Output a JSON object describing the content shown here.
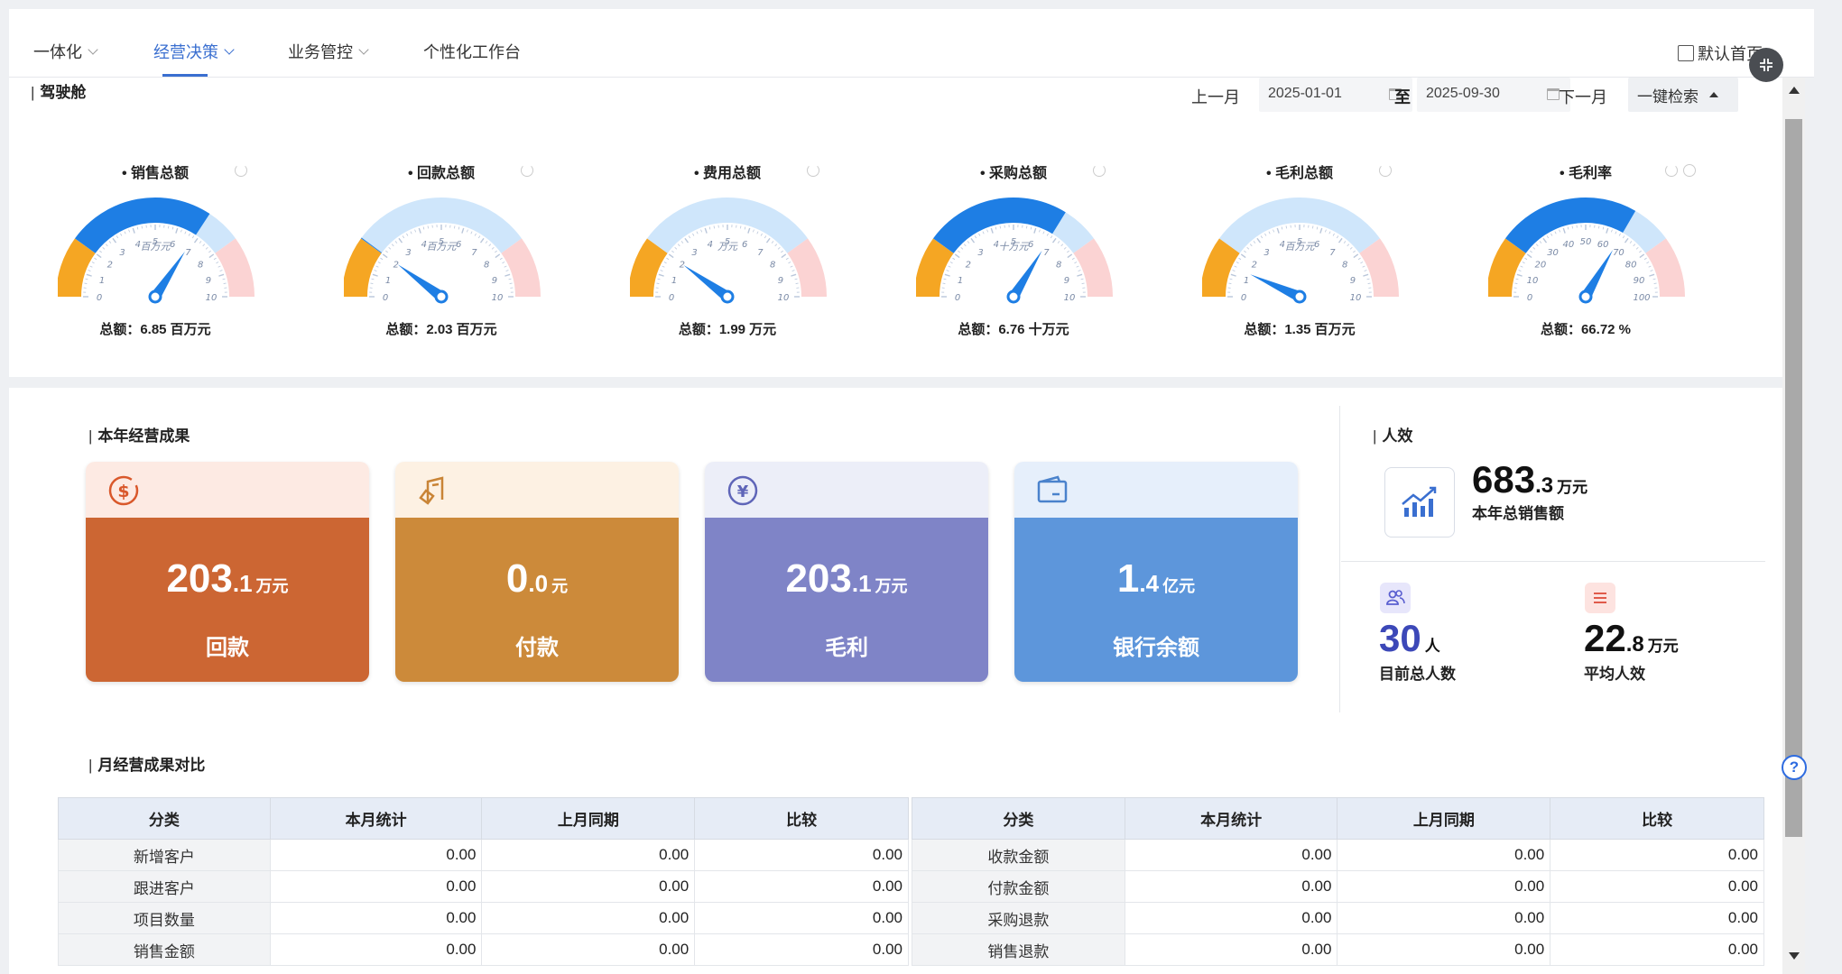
{
  "nav": {
    "tabs": [
      {
        "label": "一体化"
      },
      {
        "label": "经营决策"
      },
      {
        "label": "业务管控"
      },
      {
        "label": "个性化工作台"
      }
    ],
    "default_home": "默认首页"
  },
  "cockpit": {
    "title": "驾驶舱",
    "prev_month": "上一月",
    "next_month": "下一月",
    "start_date": "2025-01-01",
    "end_date": "2025-09-30",
    "to_label": "至",
    "search_label": "一键检索"
  },
  "gauges": [
    {
      "title": "销售总额",
      "unit_label": "百万元",
      "ticks": [
        "0",
        "1",
        "2",
        "3",
        "4",
        "5",
        "6",
        "7",
        "8",
        "9",
        "10"
      ],
      "max": 10,
      "value": 6.85,
      "total_text": "总额：6.85 百万元"
    },
    {
      "title": "回款总额",
      "unit_label": "百万元",
      "ticks": [
        "0",
        "1",
        "2",
        "3",
        "4",
        "5",
        "6",
        "7",
        "8",
        "9",
        "10"
      ],
      "max": 10,
      "value": 2.03,
      "total_text": "总额：2.03 百万元"
    },
    {
      "title": "费用总额",
      "unit_label": "万元",
      "ticks": [
        "0",
        "1",
        "2",
        "3",
        "4",
        "5",
        "6",
        "7",
        "8",
        "9",
        "10"
      ],
      "max": 10,
      "value": 1.99,
      "total_text": "总额：1.99 万元"
    },
    {
      "title": "采购总额",
      "unit_label": "十万元",
      "ticks": [
        "0",
        "1",
        "2",
        "3",
        "4",
        "5",
        "6",
        "7",
        "8",
        "9",
        "10"
      ],
      "max": 10,
      "value": 6.76,
      "total_text": "总额：6.76 十万元"
    },
    {
      "title": "毛利总额",
      "unit_label": "百万元",
      "ticks": [
        "0",
        "1",
        "2",
        "3",
        "4",
        "5",
        "6",
        "7",
        "8",
        "9",
        "10"
      ],
      "max": 10,
      "value": 1.35,
      "total_text": "总额：1.35 百万元"
    },
    {
      "title": "毛利率",
      "unit_label": "",
      "ticks": [
        "0",
        "10",
        "20",
        "30",
        "40",
        "50",
        "60",
        "70",
        "80",
        "90",
        "100"
      ],
      "max": 100,
      "value": 66.72,
      "total_text": "总额：66.72 %"
    }
  ],
  "results": {
    "title": "本年经营成果",
    "cards": [
      {
        "int": "203",
        "dec": ".1",
        "unit": "万元",
        "label": "回款",
        "icon": "dollar-icon",
        "head_color": "#fdeae3",
        "body_color": "#cc6633",
        "icon_color": "#d9582b"
      },
      {
        "int": "0",
        "dec": ".0",
        "unit": "元",
        "label": "付款",
        "icon": "payment-icon",
        "head_color": "#fdf1e3",
        "body_color": "#cc8a3a",
        "icon_color": "#c98436"
      },
      {
        "int": "203",
        "dec": ".1",
        "unit": "万元",
        "label": "毛利",
        "icon": "yen-icon",
        "head_color": "#eceef8",
        "body_color": "#7f84c7",
        "icon_color": "#5f65b8"
      },
      {
        "int": "1",
        "dec": ".4",
        "unit": "亿元",
        "label": "银行余额",
        "icon": "wallet-icon",
        "head_color": "#e6effb",
        "body_color": "#5d96db",
        "icon_color": "#4a82cc"
      }
    ]
  },
  "efficiency": {
    "title": "人效",
    "sales": {
      "int": "683",
      "dec": ".3",
      "unit": "万元",
      "caption": "本年总销售额"
    },
    "headcount": {
      "int": "30",
      "unit": "人",
      "caption": "目前总人数"
    },
    "per_capita": {
      "int": "22",
      "dec": ".8",
      "unit": "万元",
      "caption": "平均人效"
    }
  },
  "monthly": {
    "title": "月经营成果对比",
    "headers": [
      "分类",
      "本月统计",
      "上月同期",
      "比较"
    ],
    "left_rows": [
      [
        "新增客户",
        "0.00",
        "0.00",
        "0.00"
      ],
      [
        "跟进客户",
        "0.00",
        "0.00",
        "0.00"
      ],
      [
        "项目数量",
        "0.00",
        "0.00",
        "0.00"
      ],
      [
        "销售金额",
        "0.00",
        "0.00",
        "0.00"
      ]
    ],
    "right_rows": [
      [
        "收款金额",
        "0.00",
        "0.00",
        "0.00"
      ],
      [
        "付款金额",
        "0.00",
        "0.00",
        "0.00"
      ],
      [
        "采购退款",
        "0.00",
        "0.00",
        "0.00"
      ],
      [
        "销售退款",
        "0.00",
        "0.00",
        "0.00"
      ]
    ]
  },
  "colors": {
    "accent": "#3a6fd0",
    "gauge_blue": "#1e7ee4",
    "gauge_light": "#cfe6fb",
    "gauge_orange": "#f5a623",
    "gauge_pink": "#fbd3d3",
    "headcount_blue": "#3c48b8"
  }
}
